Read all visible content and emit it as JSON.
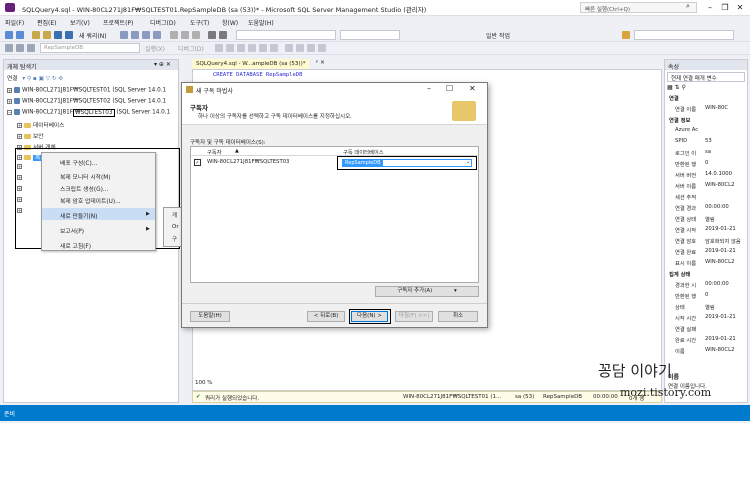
{
  "window": {
    "title": "SQLQuery4.sql - WIN-80CL271J81F₩SQLTEST01.RepSampleDB (sa (53))* - Microsoft SQL Server Management Studio (관리자)",
    "quick_launch_placeholder": "빠른 실행(Ctrl+Q)"
  },
  "menu": [
    "파일(F)",
    "편집(E)",
    "보기(V)",
    "프로젝트(P)",
    "디버그(D)",
    "도구(T)",
    "창(W)",
    "도움말(H)"
  ],
  "toolbar": {
    "new_query": "새 쿼리(N)",
    "db_combo": "RepSampleDB",
    "execute": "실행(X)",
    "debug": "디버그(D)",
    "solution_dropdown": "일반 작업",
    "search_combo": ""
  },
  "object_explorer": {
    "title": "개체 탐색기",
    "connect_label": "연결",
    "servers": [
      "WIN-80CL271J81F₩SQLTEST01 (SQL Server 14.0.1",
      "WIN-80CL271J81F₩SQLTEST02 (SQL Server 14.0.1"
    ],
    "server3_prefix": "WIN-80CL271J81F",
    "server3_instance": "₩SQLTEST03",
    "server3_suffix": "(SQL Server 14.0.1",
    "nodes": [
      "데이터베이스",
      "보안",
      "서버 개체",
      "복"
    ]
  },
  "context_menu": {
    "items": [
      "배포 구성(C)...",
      "복제 모니터 시작(M)",
      "스크립트 생성(G)...",
      "복제 암호 업데이트(U)...",
      "새로 만들기(N)",
      "보고서(P)",
      "새로 고침(F)"
    ],
    "submenu": [
      "게",
      "Or",
      "구"
    ]
  },
  "editor": {
    "tab_title": "SQLQuery4.sql - W...ampleDB (sa (53))*",
    "code_line": "CREATE DATABASE RepSampleDB",
    "zoom": "100 %",
    "status_text": "쿼리가 실행되었습니다.",
    "status_server": "WIN-80CL271J81F₩SQLTEST01 (1...",
    "status_user": "sa (53)",
    "status_db": "RepSampleDB",
    "status_time": "00:00:00",
    "status_rows": "0개 행"
  },
  "dialog": {
    "title": "새 구독 마법사",
    "heading": "구독자",
    "description": "하나 이상의 구독자를 선택하고 구독 데이터베이스를 지정하십시오.",
    "list_label": "구독자 및 구독 데이터베이스(S):",
    "col_subscriber": "구독자",
    "col_database": "구독 데이터베이스",
    "row_subscriber": "WIN-80CL271J81F₩SQLTEST03",
    "row_database": "RepSampleDB",
    "add_subscriber_button": "구독자 추가(A)",
    "help_button": "도움말(H)",
    "back_button": "< 뒤로(B)",
    "next_button": "다음(N) >",
    "finish_button": "마침(F) >>|",
    "cancel_button": "취소"
  },
  "properties": {
    "title": "속성",
    "combo": "현재 연결 매개 변수",
    "rows": [
      {
        "k": "연결",
        "v": "",
        "cat": true
      },
      {
        "k": "연결 이름",
        "v": "WIN-80C",
        "cat": false
      },
      {
        "k": "연결 정보",
        "v": "",
        "cat": true
      },
      {
        "k": "Azure Ac",
        "v": "",
        "cat": false
      },
      {
        "k": "SPID",
        "v": "53",
        "cat": false
      },
      {
        "k": "로그인 이",
        "v": "sa",
        "cat": false
      },
      {
        "k": "반환된 행",
        "v": "0",
        "cat": false
      },
      {
        "k": "서버 버전",
        "v": "14.0.1000",
        "cat": false
      },
      {
        "k": "서버 이름",
        "v": "WIN-80CL2",
        "cat": false
      },
      {
        "k": "세션 추적",
        "v": "",
        "cat": false
      },
      {
        "k": "연결 경과",
        "v": "00:00:00",
        "cat": false
      },
      {
        "k": "연결 상태",
        "v": "열림",
        "cat": false
      },
      {
        "k": "연결 시작",
        "v": "2019-01-21",
        "cat": false
      },
      {
        "k": "연결 암호",
        "v": "암호화되지 않음",
        "cat": false
      },
      {
        "k": "연결 완료",
        "v": "2019-01-21",
        "cat": false
      },
      {
        "k": "표시 이름",
        "v": "WIN-80CL2",
        "cat": false
      },
      {
        "k": "집계 상태",
        "v": "",
        "cat": true
      },
      {
        "k": "경과한 시",
        "v": "00:00:00",
        "cat": false
      },
      {
        "k": "반환된 행",
        "v": "0",
        "cat": false
      },
      {
        "k": "상태",
        "v": "열림",
        "cat": false
      },
      {
        "k": "시작 시간",
        "v": "2019-01-21",
        "cat": false
      },
      {
        "k": "연결 실패",
        "v": "",
        "cat": false
      },
      {
        "k": "완료 시간",
        "v": "2019-01-21",
        "cat": false
      },
      {
        "k": "이름",
        "v": "WIN-80CL2",
        "cat": false
      }
    ],
    "footer_line1": "이름",
    "footer_line2": "연결 이름입니다."
  },
  "statusbar": {
    "text": "준비"
  },
  "watermark": {
    "line1": "꽁담 이야기",
    "line2": "mozi.tistory.com"
  },
  "colors": {
    "accent": "#007acc",
    "dialog_highlight": "#3399ff"
  }
}
